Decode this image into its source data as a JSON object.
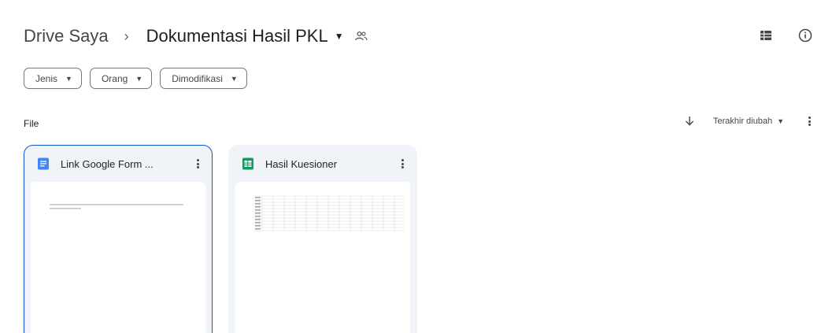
{
  "breadcrumb": {
    "root": "Drive Saya",
    "separator": "›",
    "current": "Dokumentasi Hasil PKL"
  },
  "icons": {
    "shared": "people-icon",
    "view_toggle": "list-view-icon",
    "info": "info-icon",
    "sort_direction": "arrow-down-icon"
  },
  "filters": [
    {
      "label": "Jenis"
    },
    {
      "label": "Orang"
    },
    {
      "label": "Dimodifikasi"
    }
  ],
  "section": {
    "label": "File"
  },
  "sort": {
    "label": "Terakhir diubah"
  },
  "files": [
    {
      "title": "Link Google Form ...",
      "type": "docs-icon",
      "selected": true
    },
    {
      "title": "Hasil Kuesioner",
      "type": "sheets-icon",
      "selected": false
    }
  ],
  "colors": {
    "accent": "#0b57d0",
    "card_bg": "#f0f4f9",
    "docs_blue": "#4285f4",
    "sheets_green": "#0f9d58"
  }
}
